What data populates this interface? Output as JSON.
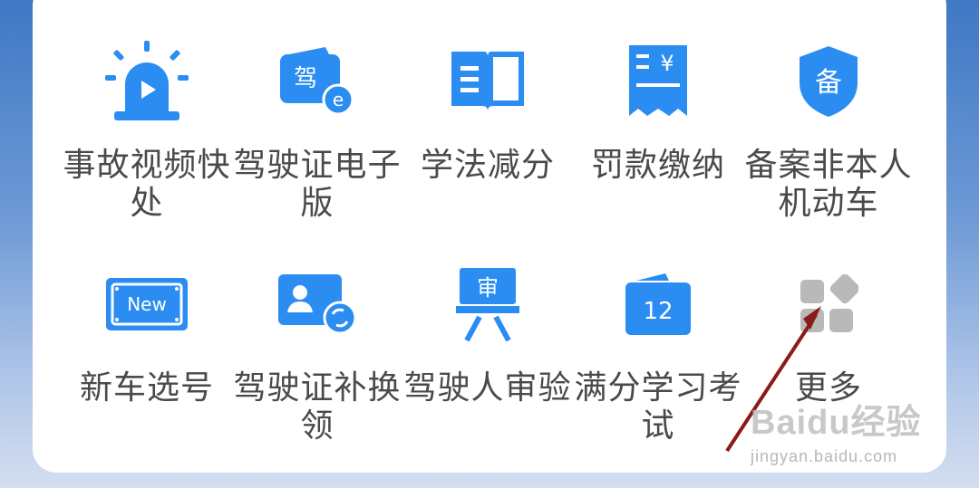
{
  "services": [
    {
      "label": "事故视频快处",
      "icon": "siren-video-icon",
      "glyph": ""
    },
    {
      "label": "驾驶证电子版",
      "icon": "e-license-icon",
      "glyph": "驾"
    },
    {
      "label": "学法减分",
      "icon": "open-book-icon",
      "glyph": ""
    },
    {
      "label": "罚款缴纳",
      "icon": "fine-receipt-icon",
      "glyph": "¥"
    },
    {
      "label": "备案非本人机动车",
      "icon": "shield-filing-icon",
      "glyph": "备"
    },
    {
      "label": "新车选号",
      "icon": "new-plate-icon",
      "glyph": "New"
    },
    {
      "label": "驾驶证补换领",
      "icon": "license-renew-icon",
      "glyph": ""
    },
    {
      "label": "驾驶人审验",
      "icon": "review-board-icon",
      "glyph": "审"
    },
    {
      "label": "满分学习考试",
      "icon": "calendar-12-icon",
      "glyph": "12"
    },
    {
      "label": "更多",
      "icon": "more-grid-icon",
      "glyph": ""
    }
  ],
  "watermark": {
    "brand": "Baidu经验",
    "url": "jingyan.baidu.com"
  },
  "colors": {
    "icon_blue": "#2b8cf2",
    "more_gray": "#b9b9b9",
    "arrow": "#8b1a1a",
    "label": "#4a4a4a"
  }
}
